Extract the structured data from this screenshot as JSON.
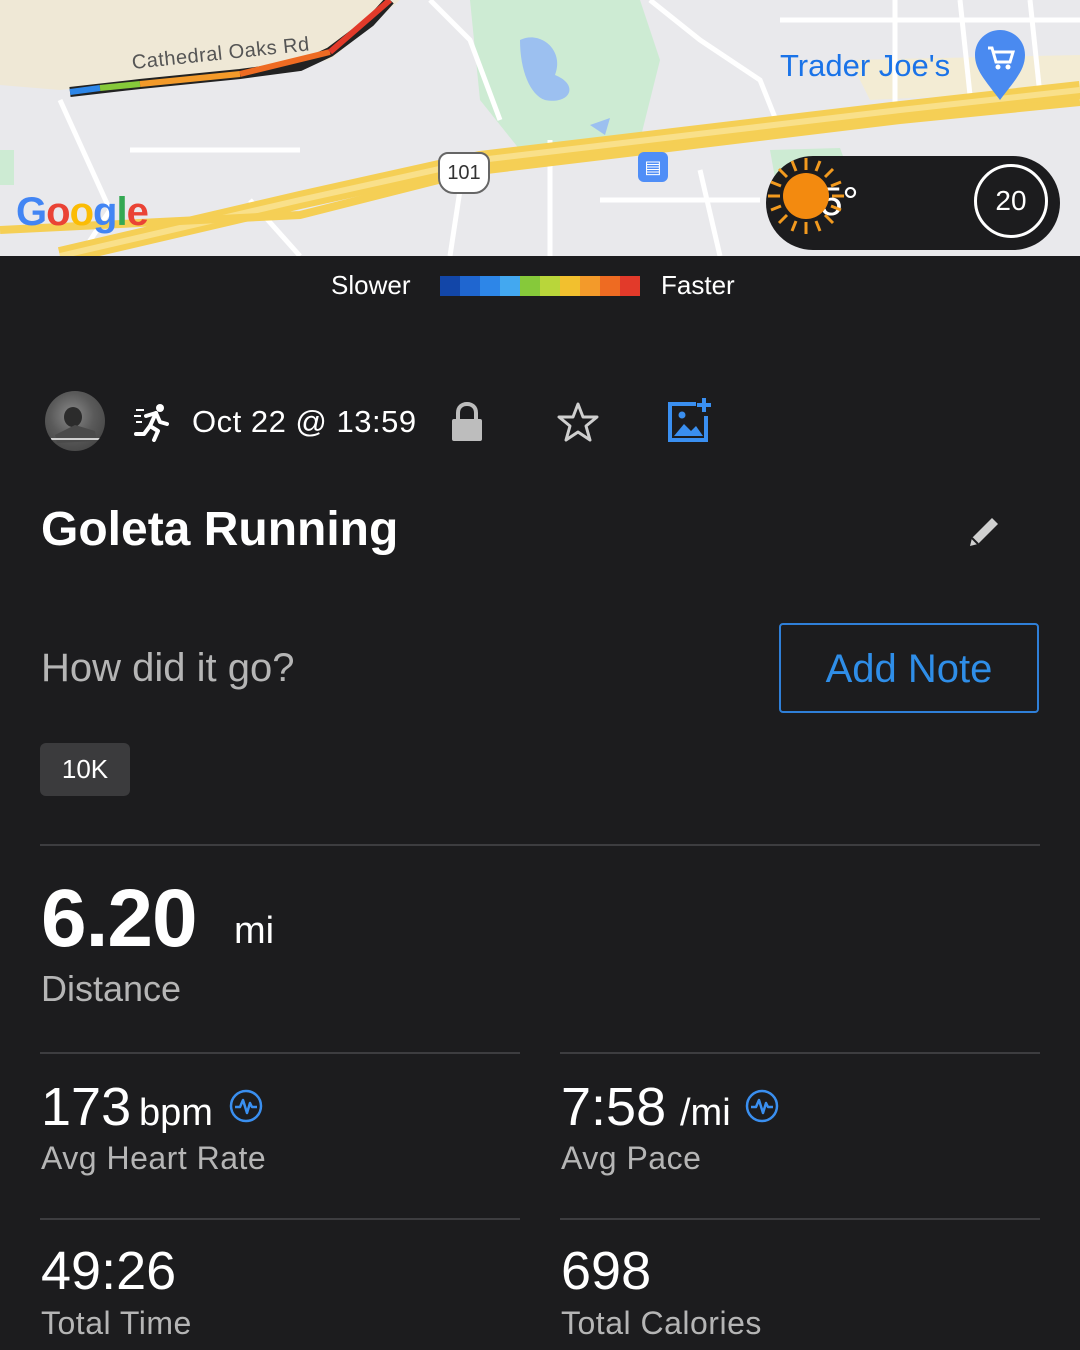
{
  "map": {
    "road_label": "Cathedral Oaks Rd",
    "poi_label": "Trader Joe's",
    "highway_shield": "101",
    "attribution": "Google"
  },
  "weather": {
    "temperature": "75°",
    "condition_icon": "sun-icon",
    "air_quality": "20"
  },
  "legend": {
    "slower_label": "Slower",
    "faster_label": "Faster",
    "colors": [
      "#1246a8",
      "#1f66d0",
      "#2d86e8",
      "#43a8f0",
      "#86c93a",
      "#b9d63a",
      "#f2c02e",
      "#f39a2a",
      "#ee6b22",
      "#e23a2a"
    ]
  },
  "activity": {
    "type_icon": "running-icon",
    "datetime": "Oct 22 @ 13:59",
    "title": "Goleta Running",
    "note_prompt": "How did it go?",
    "add_note_label": "Add Note",
    "tag": "10K"
  },
  "stats": {
    "distance": {
      "value": "6.20",
      "unit": "mi",
      "label": "Distance"
    },
    "heart_rate": {
      "value": "173",
      "unit": "bpm",
      "label": "Avg Heart Rate"
    },
    "pace": {
      "value": "7:58",
      "unit": "/mi",
      "label": "Avg Pace"
    },
    "time": {
      "value": "49:26",
      "label": "Total Time"
    },
    "calories": {
      "value": "698",
      "label": "Total Calories"
    }
  },
  "colors": {
    "background": "#1c1c1e",
    "accent": "#2f8ee8",
    "muted_text": "#b5b5b5"
  }
}
